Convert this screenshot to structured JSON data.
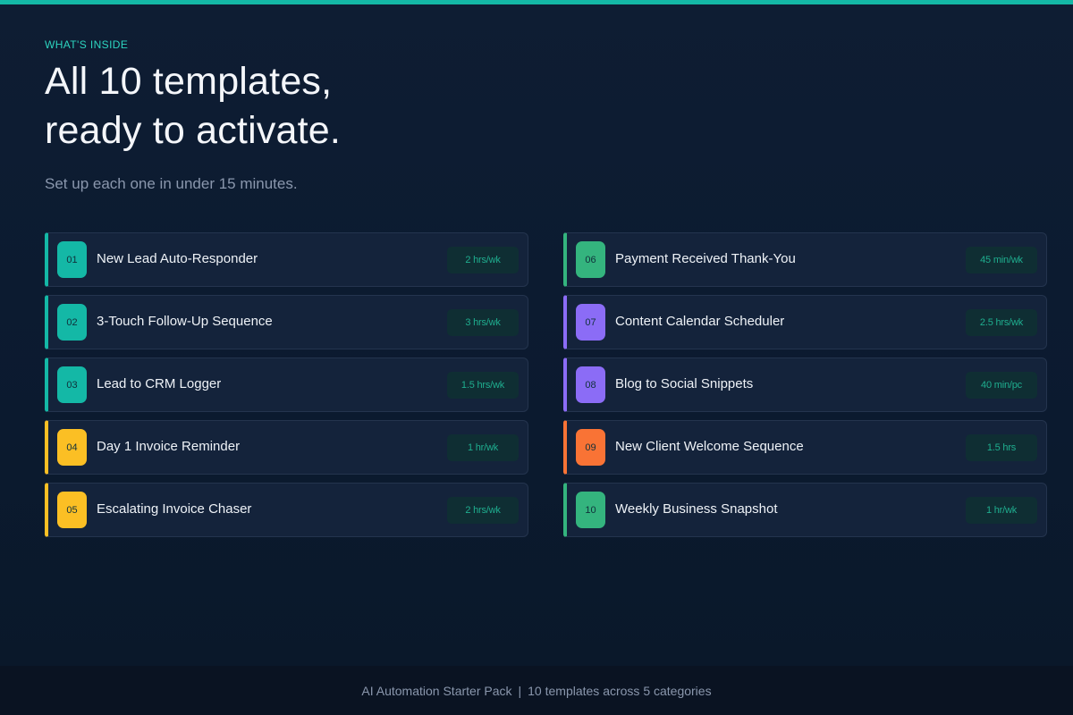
{
  "colors": {
    "accent": "#14b8a6",
    "teal": "#14b8a6",
    "amber": "#fbbf24",
    "green": "#34b47e",
    "purple": "#8b6cf6",
    "orange": "#f97335",
    "time_text": "#1fae8f"
  },
  "header": {
    "eyebrow": "WHAT'S INSIDE",
    "headline_line1": "All 10 templates,",
    "headline_line2": "ready to activate.",
    "subtitle": "Set up each one in under 15 minutes."
  },
  "templates": [
    {
      "number": "01",
      "name": "New Lead Auto-Responder",
      "time": "2 hrs/wk",
      "color": "#14b8a6"
    },
    {
      "number": "02",
      "name": "3-Touch Follow-Up Sequence",
      "time": "3 hrs/wk",
      "color": "#14b8a6"
    },
    {
      "number": "03",
      "name": "Lead to CRM Logger",
      "time": "1.5 hrs/wk",
      "color": "#14b8a6"
    },
    {
      "number": "04",
      "name": "Day 1 Invoice Reminder",
      "time": "1 hr/wk",
      "color": "#fbbf24"
    },
    {
      "number": "05",
      "name": "Escalating Invoice Chaser",
      "time": "2 hrs/wk",
      "color": "#fbbf24"
    },
    {
      "number": "06",
      "name": "Payment Received Thank-You",
      "time": "45 min/wk",
      "color": "#34b47e"
    },
    {
      "number": "07",
      "name": "Content Calendar Scheduler",
      "time": "2.5 hrs/wk",
      "color": "#8b6cf6"
    },
    {
      "number": "08",
      "name": "Blog to Social Snippets",
      "time": "40 min/pc",
      "color": "#8b6cf6"
    },
    {
      "number": "09",
      "name": "New Client Welcome Sequence",
      "time": "1.5 hrs",
      "color": "#f97335"
    },
    {
      "number": "10",
      "name": "Weekly Business Snapshot",
      "time": "1 hr/wk",
      "color": "#34b47e"
    }
  ],
  "footer": {
    "product": "AI Automation Starter Pack",
    "separator": "|",
    "summary": "10 templates across 5 categories"
  }
}
